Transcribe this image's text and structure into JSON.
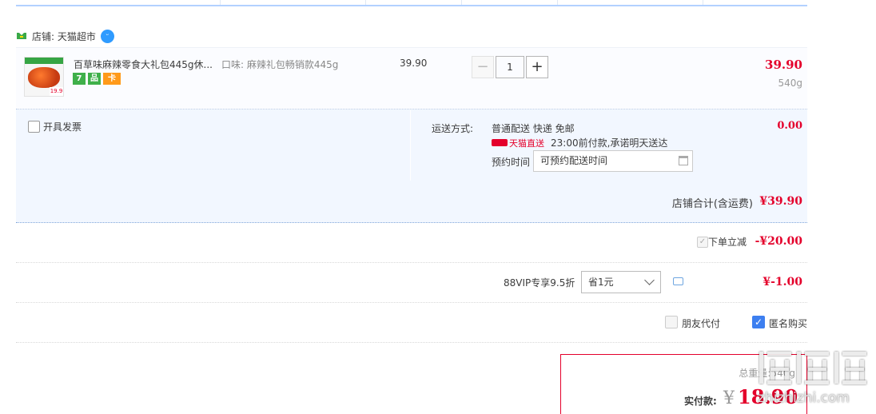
{
  "shop": {
    "label": "店铺: 天猫超市",
    "icon": "tmall-shop-icon",
    "chat_icon": "wangwang-chat-icon"
  },
  "item": {
    "title": "百草味麻辣零食大礼包445g休...",
    "sku": "口味: 麻辣礼包畅销款445g",
    "unit_price": "39.90",
    "quantity": "1",
    "line_total": "39.90",
    "weight": "540g",
    "badges": [
      "7",
      "品",
      "卡"
    ],
    "thumb_tag": "19.9"
  },
  "delivery": {
    "invoice_label": "开具发票",
    "method_label": "运送方式:",
    "method_value": "普通配送 快递 免邮",
    "tm_logo": "天猫直送",
    "promise": "23:00前付款,承诺明天送达",
    "appointment_label": "预约时间",
    "appointment_value": "可预约配送时间",
    "fee": "0.00"
  },
  "shop_total": {
    "label": "店铺合计(含运费)",
    "value": "¥39.90"
  },
  "discount": {
    "label": "下单立减",
    "value": "-¥20.00"
  },
  "vip": {
    "label": "88VIP专享9.5折",
    "select": "省1元",
    "value": "¥-1.00"
  },
  "options": {
    "friend_pay": "朋友代付",
    "anonymous": "匿名购买"
  },
  "summary": {
    "weight_label": "总重量:540g",
    "pay_label": "实付款:",
    "currency": "¥",
    "pay_value": "18.90"
  },
  "watermark": {
    "url": "zhizhizhi.com"
  },
  "colors": {
    "accent_red": "#e4002b",
    "table_blue": "#f2f7ff",
    "checkbox_blue": "#3d7ff0"
  }
}
